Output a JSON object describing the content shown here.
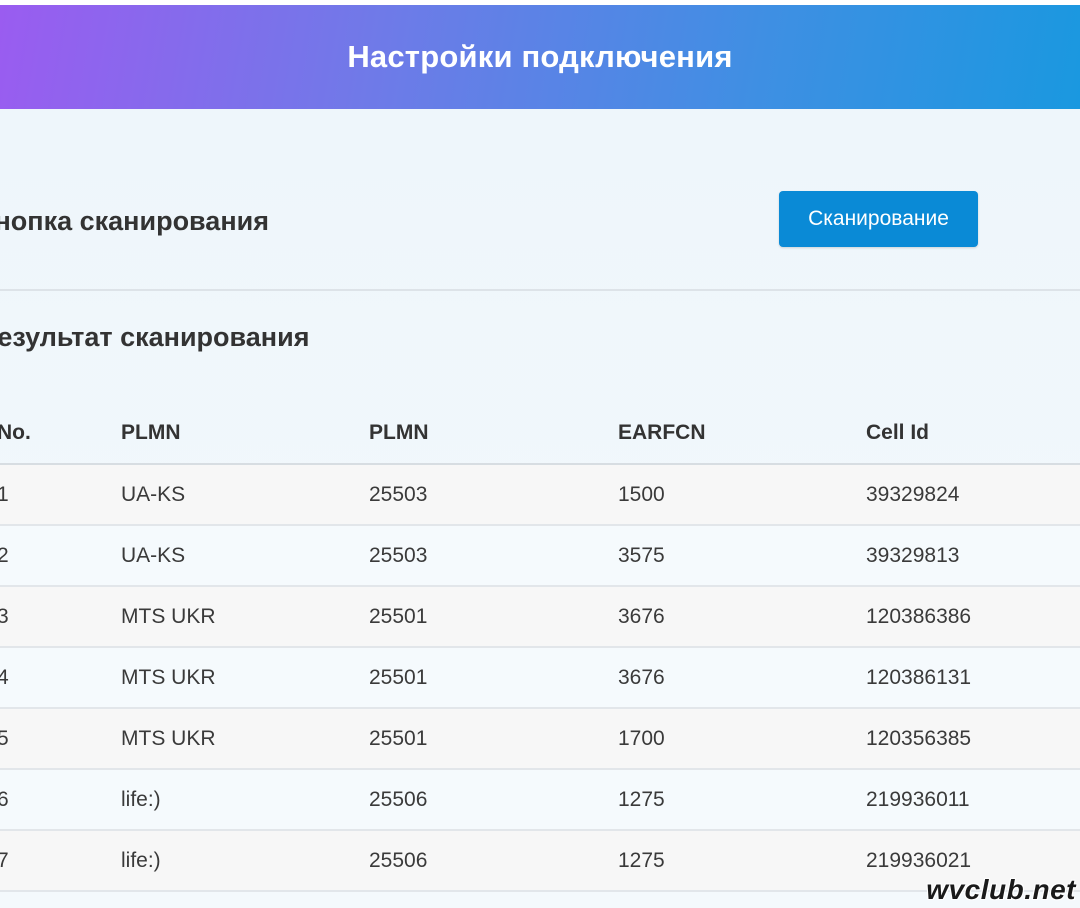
{
  "header": {
    "title": "Настройки подключения"
  },
  "scan": {
    "label": "Кнопка сканирования",
    "button_label": "Сканирование"
  },
  "results": {
    "title": "Результат сканирования",
    "columns": [
      "No.",
      "PLMN",
      "PLMN",
      "EARFCN",
      "Cell Id"
    ],
    "rows": [
      [
        "1",
        "UA-KS",
        "25503",
        "1500",
        "39329824"
      ],
      [
        "2",
        "UA-KS",
        "25503",
        "3575",
        "39329813"
      ],
      [
        "3",
        "MTS UKR",
        "25501",
        "3676",
        "120386386"
      ],
      [
        "4",
        "MTS UKR",
        "25501",
        "3676",
        "120386131"
      ],
      [
        "5",
        "MTS UKR",
        "25501",
        "1700",
        "120356385"
      ],
      [
        "6",
        "life:)",
        "25506",
        "1275",
        "219936011"
      ],
      [
        "7",
        "life:)",
        "25506",
        "1275",
        "219936021"
      ]
    ]
  },
  "watermark": "wvclub.net",
  "colors": {
    "header_gradient_start": "#9a5cf0",
    "header_gradient_end": "#1a98e0",
    "button_bg": "#0a8ad6"
  }
}
